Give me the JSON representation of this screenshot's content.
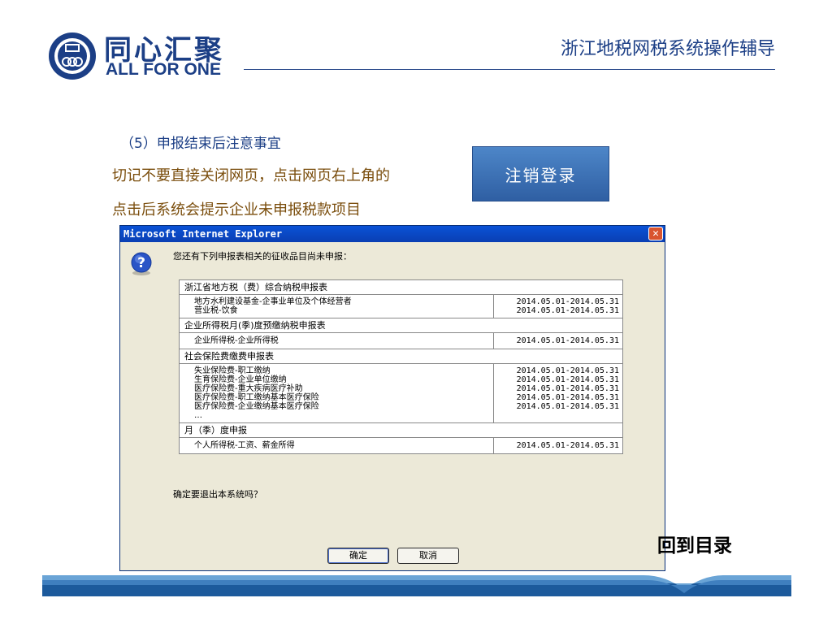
{
  "header": {
    "brand_cn": "同心汇聚",
    "brand_en": "ALL FOR ONE",
    "title": "浙江地税网税系统操作辅导"
  },
  "content": {
    "step_title": "（5）申报结束后注意事宜",
    "line1": "切记不要直接关闭网页，点击网页右上角的",
    "line2": "点击后系统会提示企业未申报税款项目",
    "logout_button": "注销登录"
  },
  "dialog": {
    "title": "Microsoft Internet Explorer",
    "close_symbol": "✕",
    "message": "您还有下列申报表相关的征收品目尚未申报：",
    "sections": [
      {
        "header": "浙江省地方税（费）综合纳税申报表",
        "items": [
          "地方水利建设基金-企事业单位及个体经营者",
          "营业税-饮食"
        ],
        "dates": [
          "2014.05.01-2014.05.31",
          "2014.05.01-2014.05.31"
        ]
      },
      {
        "header": "企业所得税月(季)度预缴纳税申报表",
        "items": [
          "企业所得税-企业所得税"
        ],
        "dates": [
          "2014.05.01-2014.05.31"
        ]
      },
      {
        "header": "社会保险费缴费申报表",
        "items": [
          "失业保险费-职工缴纳",
          "生育保险费-企业单位缴纳",
          "医疗保险费-重大疾病医疗补助",
          "医疗保险费-职工缴纳基本医疗保险",
          "医疗保险费-企业缴纳基本医疗保险",
          "…"
        ],
        "dates": [
          "2014.05.01-2014.05.31",
          "2014.05.01-2014.05.31",
          "2014.05.01-2014.05.31",
          "2014.05.01-2014.05.31",
          "2014.05.01-2014.05.31"
        ]
      },
      {
        "header": "月（季）度申报",
        "items": [
          "个人所得税-工资、薪金所得"
        ],
        "dates": [
          "2014.05.01-2014.05.31"
        ]
      }
    ],
    "confirm_question": "确定要退出本系统吗？",
    "ok_label": "确定",
    "cancel_label": "取消"
  },
  "footer": {
    "back_link": "回到目录"
  },
  "colors": {
    "brand_blue": "#1c3f86",
    "body_text_brown": "#7a4d0c",
    "dialog_bg": "#ece9d8",
    "titlebar_blue": "#0a52d6"
  },
  "icons": {
    "logo": "ring-emblem-icon",
    "dialog": "question-icon",
    "close": "close-icon"
  }
}
